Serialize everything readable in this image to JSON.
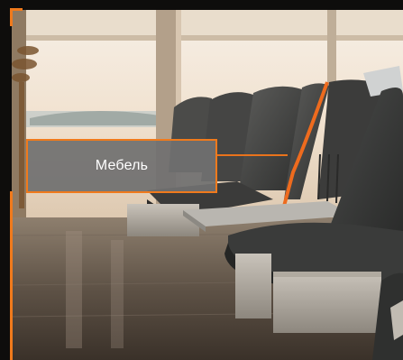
{
  "hotspot": {
    "label": "Мебель"
  },
  "colors": {
    "accent": "#f07a1c",
    "label_background": "#707070",
    "label_text": "#ffffff"
  },
  "scene": {
    "icon": "airport-waiting-lounge-photo"
  }
}
